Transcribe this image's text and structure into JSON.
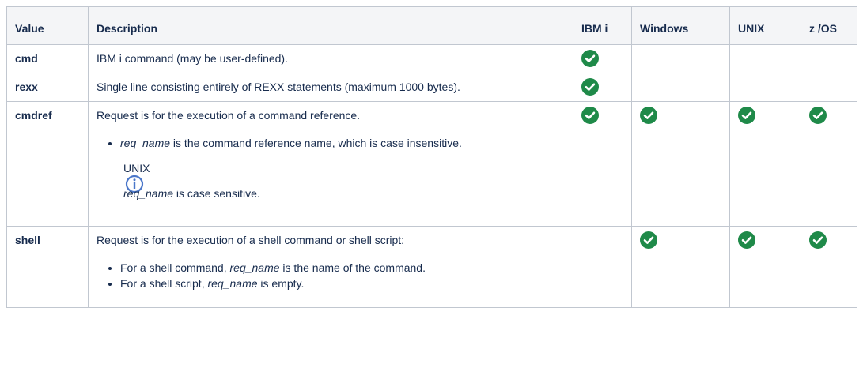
{
  "table": {
    "headers": {
      "value": "Value",
      "description": "Description",
      "ibmi": "IBM i",
      "windows": "Windows",
      "unix": "UNIX",
      "zos": "z /OS"
    },
    "rows": [
      {
        "value": "cmd",
        "description": "IBM i command (may be user-defined).",
        "ibmi": true,
        "windows": false,
        "unix": false,
        "zos": false
      },
      {
        "value": "rexx",
        "description": "Single line consisting entirely of REXX statements (maximum 1000 bytes).",
        "ibmi": true,
        "windows": false,
        "unix": false,
        "zos": false
      },
      {
        "value": "cmdref",
        "description": "Request is for the execution of a command reference.",
        "bullet": {
          "term": "req_name",
          "text": " is the command reference name, which is case insensitive."
        },
        "note": {
          "title": "UNIX",
          "term": "req_name",
          "text": " is case sensitive."
        },
        "ibmi": true,
        "windows": true,
        "unix": true,
        "zos": true
      },
      {
        "value": "shell",
        "description": "Request is for the execution of a shell command or shell script:",
        "bullets": [
          {
            "prefix": "For a shell command, ",
            "term": "req_name",
            "suffix": " is the name of the command."
          },
          {
            "prefix": "For a shell script, ",
            "term": "req_name",
            "suffix": " is empty."
          }
        ],
        "ibmi": false,
        "windows": true,
        "unix": true,
        "zos": true
      }
    ]
  },
  "colors": {
    "check": "#1f8a49",
    "info_icon": "#4a76c9",
    "border": "#c1c7d0",
    "header_bg": "#f4f5f7"
  },
  "icons": {
    "check": "check-circle-icon",
    "info": "info-icon"
  }
}
